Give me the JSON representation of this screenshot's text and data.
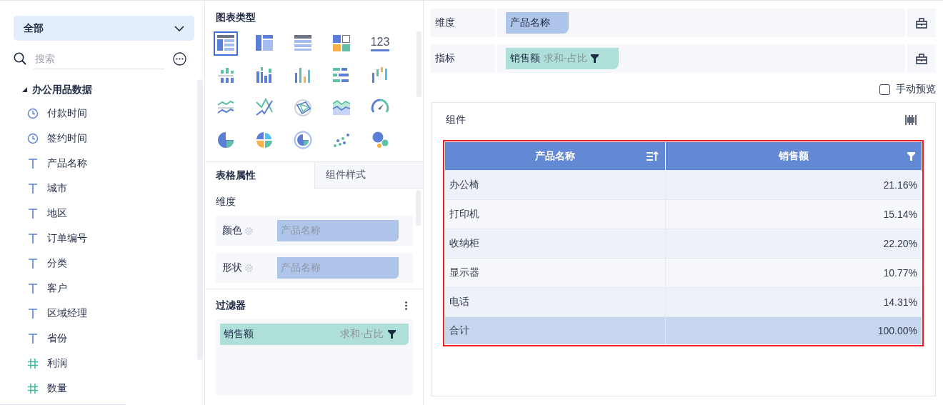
{
  "fields_panel": {
    "dropdown": {
      "value": "全部"
    },
    "search": {
      "placeholder": "搜索"
    },
    "tree": {
      "label": "办公用品数据",
      "expanded": true,
      "children": [
        {
          "label": "付款时间",
          "kind": "time"
        },
        {
          "label": "签约时间",
          "kind": "time"
        },
        {
          "label": "产品名称",
          "kind": "text"
        },
        {
          "label": "城市",
          "kind": "text"
        },
        {
          "label": "地区",
          "kind": "text"
        },
        {
          "label": "订单编号",
          "kind": "text"
        },
        {
          "label": "分类",
          "kind": "text"
        },
        {
          "label": "客户",
          "kind": "text"
        },
        {
          "label": "区域经理",
          "kind": "text"
        },
        {
          "label": "省份",
          "kind": "text"
        },
        {
          "label": "利润",
          "kind": "number"
        },
        {
          "label": "数量",
          "kind": "number"
        }
      ]
    }
  },
  "chart_types": {
    "title": "图表类型",
    "items": [
      {
        "kind": "group-table",
        "selected": true
      },
      {
        "kind": "cross-table",
        "selected": false
      },
      {
        "kind": "detail-table",
        "selected": false
      },
      {
        "kind": "tile",
        "selected": false
      },
      {
        "kind": "number",
        "label": "123",
        "selected": false
      },
      {
        "kind": "stacked-bar",
        "selected": false
      },
      {
        "kind": "multi-bar",
        "selected": false
      },
      {
        "kind": "bar",
        "selected": false
      },
      {
        "kind": "hbar",
        "selected": false
      },
      {
        "kind": "range-bar",
        "selected": false
      },
      {
        "kind": "line",
        "selected": false
      },
      {
        "kind": "cross-line",
        "selected": false
      },
      {
        "kind": "radar",
        "selected": false
      },
      {
        "kind": "area",
        "selected": false
      },
      {
        "kind": "gauge",
        "selected": false
      },
      {
        "kind": "pie",
        "selected": false
      },
      {
        "kind": "rose",
        "selected": false
      },
      {
        "kind": "ring",
        "selected": false
      },
      {
        "kind": "scatter",
        "selected": false
      },
      {
        "kind": "bubble",
        "selected": false
      }
    ]
  },
  "property_tabs": [
    {
      "label": "表格属性",
      "selected": true
    },
    {
      "label": "组件样式",
      "selected": false
    }
  ],
  "properties": {
    "section": "维度",
    "rows": [
      {
        "label": "颜色",
        "value": "产品名称",
        "disabled": true
      },
      {
        "label": "形状",
        "value": "产品名称",
        "disabled": true
      }
    ]
  },
  "filter": {
    "title": "过滤器",
    "items": [
      {
        "field": "销售额",
        "aggregation": "求和-占比"
      }
    ]
  },
  "dimension": {
    "label": "维度",
    "pills": [
      {
        "text": "产品名称"
      }
    ]
  },
  "measure": {
    "label": "指标",
    "pills": [
      {
        "text": "销售额",
        "aggregation": "求和-占比"
      }
    ]
  },
  "manual_preview": {
    "label": "手动预览",
    "checked": false
  },
  "component": {
    "title": "组件",
    "highlighted": true,
    "table": {
      "columns": [
        {
          "label": "产品名称"
        },
        {
          "label": "销售额"
        }
      ],
      "rows": [
        [
          "办公椅",
          "21.16%"
        ],
        [
          "打印机",
          "15.14%"
        ],
        [
          "收纳柜",
          "22.20%"
        ],
        [
          "显示器",
          "10.77%"
        ],
        [
          "电话",
          "14.31%"
        ]
      ],
      "total": [
        "合计",
        "100.00%"
      ]
    }
  }
}
